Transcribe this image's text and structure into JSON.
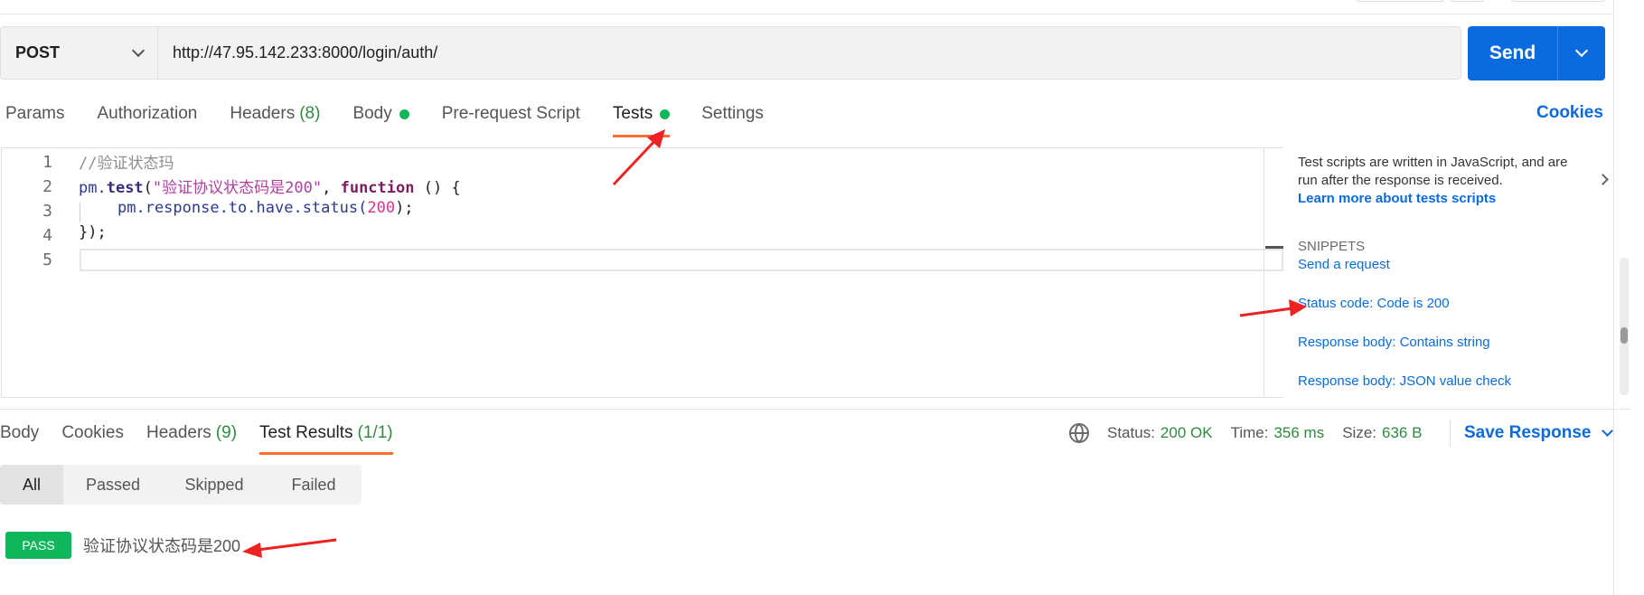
{
  "request": {
    "method": "POST",
    "url": "http://47.95.142.233:8000/login/auth/",
    "send_label": "Send"
  },
  "request_tabs": [
    {
      "label": "Params"
    },
    {
      "label": "Authorization"
    },
    {
      "label": "Headers",
      "count": "(8)"
    },
    {
      "label": "Body"
    },
    {
      "label": "Pre-request Script"
    },
    {
      "label": "Tests"
    },
    {
      "label": "Settings"
    }
  ],
  "cookies_label": "Cookies",
  "editor": {
    "line_numbers": [
      "1",
      "2",
      "3",
      "4",
      "5"
    ],
    "line1": "//验证状态玛",
    "line2_pm": "pm.",
    "line2_fn": "test",
    "line2_open": "(",
    "line2_str": "\"验证协议状态码是200\"",
    "line2_comma": ", ",
    "line2_kw": "function",
    "line2_rest": " () {",
    "line3_obj": "pm.response.to.have.status(",
    "line3_num": "200",
    "line3_close": ");",
    "line4": "});"
  },
  "side_panel": {
    "description": "Test scripts are written in JavaScript, and are run after the response is received.",
    "learn_more": "Learn more about tests scripts",
    "snippets_heading": "SNIPPETS",
    "snippets": [
      "Send a request",
      "Status code: Code is 200",
      "Response body: Contains string",
      "Response body: JSON value check"
    ]
  },
  "response_tabs": [
    {
      "label": "Body"
    },
    {
      "label": "Cookies"
    },
    {
      "label": "Headers",
      "count": "(9)"
    },
    {
      "label": "Test Results",
      "count": "(1/1)"
    }
  ],
  "response_status": {
    "status_label": "Status:",
    "status_value": "200 OK",
    "time_label": "Time:",
    "time_value": "356 ms",
    "size_label": "Size:",
    "size_value": "636 B",
    "save_label": "Save Response"
  },
  "filters": [
    "All",
    "Passed",
    "Skipped",
    "Failed"
  ],
  "result": {
    "badge": "PASS",
    "name": "验证协议状态码是200"
  },
  "colors": {
    "accent_blue": "#0b6bde",
    "pass_green": "#11b55b",
    "tab_underline": "#ff6c37",
    "annotation_arrow": "#ee2222"
  },
  "icons": [
    "chevron-down-icon",
    "globe-icon",
    "chevron-right-icon",
    "status-dot-icon"
  ]
}
